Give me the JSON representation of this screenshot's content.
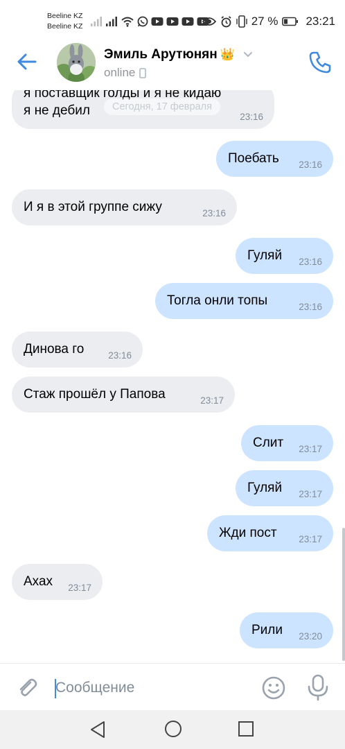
{
  "statusbar": {
    "carrier1": "Beeline KZ",
    "carrier2": "Beeline KZ",
    "battery": "27 %",
    "time": "23:21",
    "icons": [
      "signal-icon",
      "signal-icon",
      "wifi-icon",
      "whatsapp-icon",
      "youtube-icon",
      "youtube-icon",
      "youtube-icon",
      "youtube-icon",
      "eye-icon",
      "alarm-icon",
      "vibrate-icon",
      "battery-icon"
    ]
  },
  "header": {
    "name": "Эмиль Арутюнян",
    "crown": "👑",
    "status": "online"
  },
  "chat": {
    "date_chip": "Сегодня, 17 февраля",
    "messages": [
      {
        "dir": "in",
        "text1": "я поставщик голды и я не кидаю",
        "text2": "я не дебил",
        "time": "23:16"
      },
      {
        "dir": "out",
        "text": "Поебать",
        "time": "23:16"
      },
      {
        "dir": "in",
        "text": "И  я в этой группе сижу",
        "time": "23:16"
      },
      {
        "dir": "out",
        "text": "Гуляй",
        "time": "23:16"
      },
      {
        "dir": "out",
        "text": "Тогла онли топы",
        "time": "23:16"
      },
      {
        "dir": "in",
        "text": "Динова го",
        "time": "23:16"
      },
      {
        "dir": "in",
        "text": "Стаж прошёл у Папова",
        "time": "23:17"
      },
      {
        "dir": "out",
        "text": "Слит",
        "time": "23:17"
      },
      {
        "dir": "out",
        "text": "Гуляй",
        "time": "23:17"
      },
      {
        "dir": "out",
        "text": "Жди пост",
        "time": "23:17"
      },
      {
        "dir": "in",
        "text": "Ахах",
        "time": "23:17"
      },
      {
        "dir": "out",
        "text": "Рили",
        "time": "23:20"
      }
    ]
  },
  "composer": {
    "placeholder": "Сообщение"
  },
  "colors": {
    "accent": "#3f8ae0",
    "incoming_bubble": "#ebedf0",
    "outgoing_bubble": "#cce4ff",
    "time_text": "#818c99"
  }
}
